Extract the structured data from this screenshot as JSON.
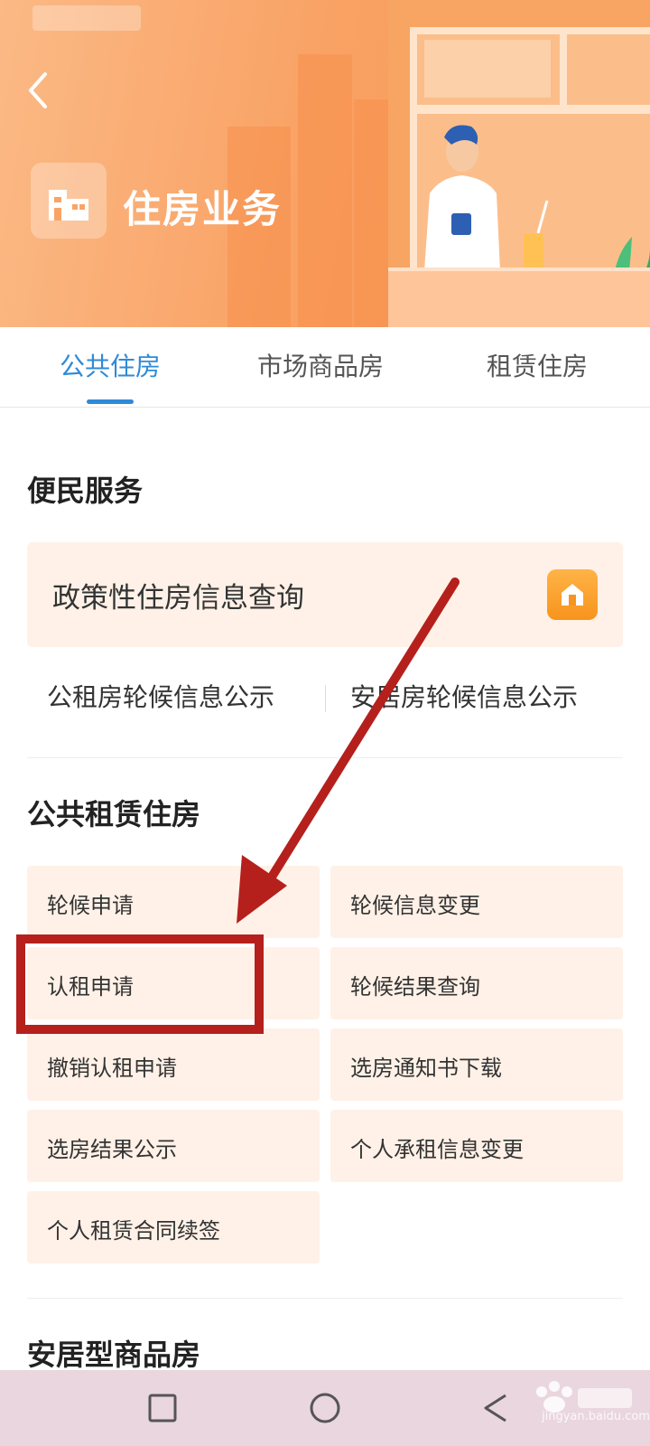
{
  "header": {
    "title": "住房业务",
    "back_icon": "chevron-left-icon",
    "title_icon": "building-icon"
  },
  "tabs": [
    {
      "label": "公共住房",
      "active": true
    },
    {
      "label": "市场商品房",
      "active": false
    },
    {
      "label": "租赁住房",
      "active": false
    }
  ],
  "sections": {
    "convenience": {
      "title": "便民服务",
      "policy_card": {
        "label": "政策性住房信息查询",
        "icon": "house-icon"
      },
      "links": [
        "公租房轮候信息公示",
        "安居房轮候信息公示"
      ]
    },
    "public_rental": {
      "title": "公共租赁住房",
      "items": [
        "轮候申请",
        "轮候信息变更",
        "认租申请",
        "轮候结果查询",
        "撤销认租申请",
        "选房通知书下载",
        "选房结果公示",
        "个人承租信息变更",
        "个人租赁合同续签"
      ]
    },
    "affordable": {
      "title": "安居型商品房"
    }
  },
  "navbar": {
    "recent_icon": "square-icon",
    "home_icon": "circle-icon",
    "back_icon": "triangle-back-icon"
  },
  "watermark": {
    "text": "jingyan.baidu.com"
  },
  "colors": {
    "accent_blue": "#2f8ad8",
    "banner_orange": "#f9a366",
    "card_bg": "#fff1e7",
    "annotation_red": "#b5201c"
  }
}
